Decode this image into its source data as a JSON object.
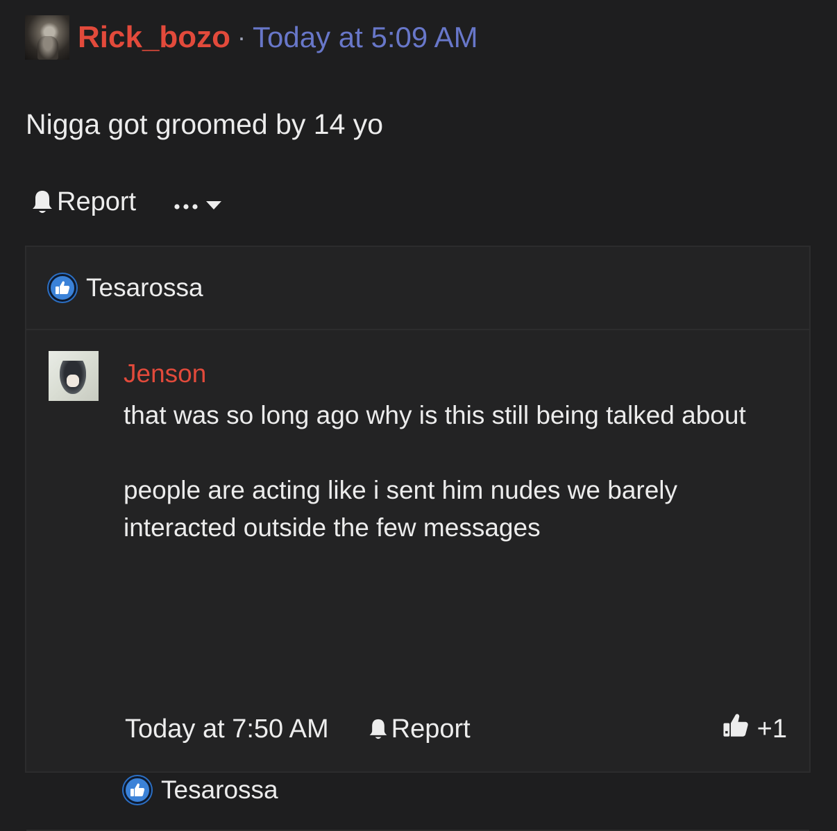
{
  "post": {
    "username": "Rick_bozo",
    "separator": "·",
    "timestamp": "Today at 5:09 AM",
    "text": "Nigga got groomed by 14 yo",
    "report_label": "Report",
    "more_icon": "ellipsis-icon"
  },
  "likes": {
    "names": "Tesarossa",
    "icon": "thumbs-up-icon",
    "color": "#3b82d8"
  },
  "comment": {
    "author": "Jenson",
    "paragraphs": [
      "that was so long ago why is this still being talked about",
      "people are acting like i sent him nudes we barely interacted outside the few messages"
    ],
    "timestamp": "Today at 7:50 AM",
    "report_label": "Report",
    "like_label": "+1",
    "likes_names": "Tesarossa"
  },
  "colors": {
    "username": "#e24a3b",
    "timestamp": "#6877c9",
    "background": "#1e1e1f",
    "panel": "#232324"
  }
}
